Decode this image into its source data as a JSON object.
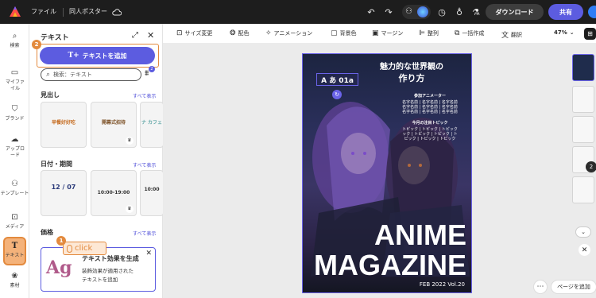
{
  "topbar": {
    "file_label": "ファイル",
    "doc_title": "同人ポスター",
    "download_label": "ダウンロード",
    "share_label": "共有"
  },
  "rail": {
    "items": [
      {
        "label": "検索",
        "icon": "search-icon"
      },
      {
        "label": "マイファイル",
        "icon": "folder-icon"
      },
      {
        "label": "ブランド",
        "icon": "brand-icon"
      },
      {
        "label": "アップロード",
        "icon": "upload-icon"
      },
      {
        "label": "テンプレート",
        "icon": "template-icon"
      },
      {
        "label": "メディア",
        "icon": "media-icon"
      },
      {
        "label": "テキスト",
        "icon": "text-icon"
      },
      {
        "label": "素材",
        "icon": "elements-icon"
      }
    ]
  },
  "panel": {
    "title": "テキスト",
    "add_text_label": "テキストを追加",
    "search_placeholder": "検索：テキスト",
    "filter_count": "2",
    "headings": {
      "title": "見出し",
      "see_all": "すべて表示",
      "samples": [
        "早餐好好吃",
        "開幕式招待",
        "ナ カフェ"
      ]
    },
    "dates": {
      "title": "日付・期間",
      "see_all": "すべて表示",
      "samples": [
        "12 / 07",
        "10:00-19:00",
        "10:00"
      ]
    },
    "prices": {
      "title": "価格",
      "see_all": "すべて表示"
    },
    "effect": {
      "sample": "Ag",
      "title": "テキスト効果を生成",
      "desc1": "装飾効果が適用された",
      "desc2": "テキストを追加"
    }
  },
  "callouts": {
    "step1": "1",
    "step2": "2",
    "click_label": "click"
  },
  "toolbar": {
    "items": [
      "サイズ変更",
      "配色",
      "アニメーション",
      "背景色",
      "マージン",
      "整列",
      "一括作成",
      "翻訳"
    ],
    "zoom": "47%"
  },
  "poster": {
    "title_line1": "魅力的な世界観の",
    "title_line2": "作り方",
    "animators_title": "参加アニメーター",
    "animators": [
      "名字名前 | 名字名前 | 名字名前",
      "名字名前 | 名字名前 | 名字名前",
      "名字名前 | 名字名前 | 名字名前"
    ],
    "topics_title": "今月の注目トピック",
    "topics": [
      "トピック | トピック | トピック",
      "ック | トピック | トピック | ト",
      "ピック | トピック | トピック"
    ],
    "selected_text": "A あ 01a",
    "big1": "ANIME",
    "big2": "MAGAZINE",
    "date": "FEB 2022  Vol.20"
  },
  "pages": {
    "count_badge": "2",
    "add_page_label": "ページを追加"
  }
}
